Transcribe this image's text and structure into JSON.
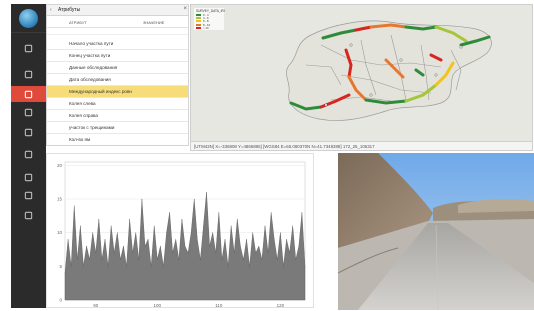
{
  "attributes_panel": {
    "title": "Атрибуты",
    "back_icon": "chevron-left-icon",
    "close_icon": "close-icon",
    "col_attribute": "АТРИБУТ",
    "col_value": "ЗНАЧЕНИЕ",
    "rows": [
      {
        "label": "Начало участка пути",
        "highlight": false
      },
      {
        "label": "Конец участка пути",
        "highlight": false
      },
      {
        "label": "Данные обследования",
        "highlight": false
      },
      {
        "label": "Дата обследования",
        "highlight": false
      },
      {
        "label": "Международный индекс ровн",
        "highlight": true
      },
      {
        "label": "Колея слева",
        "highlight": false
      },
      {
        "label": "Колея справа",
        "highlight": false
      },
      {
        "label": "участок с трещинами",
        "highlight": false
      },
      {
        "label": "Кол-во ям",
        "highlight": false
      }
    ]
  },
  "nav": {
    "items": [
      {
        "icon": "logo-globe-icon",
        "active": false
      },
      {
        "icon": "user-icon",
        "active": false
      },
      {
        "icon": "home-icon",
        "active": false
      },
      {
        "icon": "road-icon",
        "active": true
      },
      {
        "icon": "calendar-icon",
        "active": false
      },
      {
        "icon": "layers-icon",
        "active": false
      },
      {
        "icon": "list-icon",
        "active": false
      },
      {
        "icon": "users-icon",
        "active": false
      },
      {
        "icon": "translate-icon",
        "active": false
      },
      {
        "icon": "mountain-icon",
        "active": false
      }
    ]
  },
  "map": {
    "legend_title": "SURVEY_DATA_IRI",
    "legend": [
      {
        "label": "0 - 4",
        "color": "#2e8b3a"
      },
      {
        "label": "4 - 6",
        "color": "#a4c639"
      },
      {
        "label": "6 - 8",
        "color": "#f0c419"
      },
      {
        "label": "8 - 10",
        "color": "#e8772e"
      },
      {
        "label": "> 10",
        "color": "#d7261e"
      }
    ],
    "coordinates": "[UTM43N]  X=-336808  Y=4866885]  [WGS84  E=65.080370N  N=41.7348388]  172_25_106317"
  },
  "chart_data": {
    "type": "area",
    "x_ticks": [
      90,
      100,
      110,
      120
    ],
    "y_ticks": [
      0,
      5,
      10,
      15,
      20
    ],
    "ylim": [
      0,
      20.5
    ],
    "xlim": [
      85,
      124
    ],
    "color": "#7a7a7a",
    "x": [
      85,
      85.5,
      86,
      86.5,
      87,
      87.5,
      88,
      88.5,
      89,
      89.5,
      90,
      90.5,
      91,
      91.5,
      92,
      92.5,
      93,
      93.5,
      94,
      94.5,
      95,
      95.5,
      96,
      96.5,
      97,
      97.5,
      98,
      98.5,
      99,
      99.5,
      100,
      100.5,
      101,
      101.5,
      102,
      102.5,
      103,
      103.5,
      104,
      104.5,
      105,
      105.5,
      106,
      106.5,
      107,
      107.5,
      108,
      108.5,
      109,
      109.5,
      110,
      110.5,
      111,
      111.5,
      112,
      112.5,
      113,
      113.5,
      114,
      114.5,
      115,
      115.5,
      116,
      116.5,
      117,
      117.5,
      118,
      118.5,
      119,
      119.5,
      120,
      120.5,
      121,
      121.5,
      122,
      122.5,
      123,
      123.5,
      124
    ],
    "y": [
      4,
      9,
      5,
      14,
      6,
      11,
      5,
      8,
      6,
      10,
      7,
      12,
      6,
      9,
      5,
      11,
      7,
      10,
      6,
      8,
      5,
      12,
      7,
      10,
      6,
      15,
      8,
      9,
      5,
      11,
      6,
      8,
      5,
      10,
      13,
      7,
      9,
      6,
      12,
      8,
      7,
      10,
      15,
      9,
      6,
      11,
      16,
      8,
      10,
      7,
      13,
      6,
      9,
      5,
      11,
      7,
      12,
      8,
      6,
      9,
      5,
      10,
      7,
      8,
      6,
      11,
      7,
      13,
      9,
      6,
      10,
      5,
      9,
      7,
      11,
      6,
      8,
      13,
      5
    ]
  },
  "photo": {
    "icon": "road-photo"
  }
}
